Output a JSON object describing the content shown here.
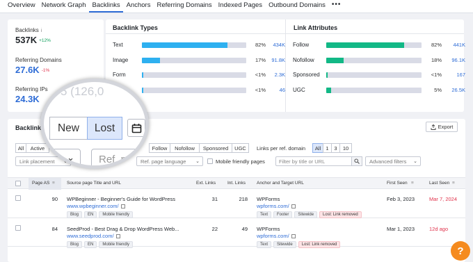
{
  "tabs": [
    "Overview",
    "Network Graph",
    "Backlinks",
    "Anchors",
    "Referring Domains",
    "Indexed Pages",
    "Outbound Domains"
  ],
  "tabs_more": "•••",
  "stats": {
    "backlinks": {
      "label": "Backlinks",
      "info": "i",
      "value": "537K",
      "delta": "+12%"
    },
    "referring_domains": {
      "label": "Referring Domains",
      "value": "27.6K",
      "delta": "-1%"
    },
    "referring_ips": {
      "label": "Referring IPs",
      "value": "24.3K"
    }
  },
  "backlink_types": {
    "title": "Backlink Types",
    "rows": [
      {
        "label": "Text",
        "pct": "82%",
        "count": "434K",
        "fill": 0.82
      },
      {
        "label": "Image",
        "pct": "17%",
        "count": "91.8K",
        "fill": 0.17
      },
      {
        "label": "Form",
        "pct": "<1%",
        "count": "2.3K",
        "fill": 0.005
      },
      {
        "label": "Frame",
        "pct": "<1%",
        "count": "46",
        "fill": 0.005
      }
    ]
  },
  "link_attributes": {
    "title": "Link Attributes",
    "rows": [
      {
        "label": "Follow",
        "pct": "82%",
        "count": "441K",
        "fill": 0.82
      },
      {
        "label": "Nofollow",
        "pct": "18%",
        "count": "96.1K",
        "fill": 0.18
      },
      {
        "label": "Sponsored",
        "pct": "<1%",
        "count": "167",
        "fill": 0.005
      },
      {
        "label": "UGC",
        "pct": "5%",
        "count": "26.5K",
        "fill": 0.05
      }
    ]
  },
  "colors": {
    "accent": "#2e6cd6",
    "types_bar": "#2eb0f0",
    "follow_bar": "#12b886",
    "negative": "#e0324b",
    "positive": "#0a9d58",
    "help": "#f58b1f"
  },
  "backlinks_section": {
    "title": "Backlinks",
    "export_label": "Export",
    "export_icon": "export-icon"
  },
  "filters": {
    "type_options": [
      "All",
      "Active"
    ],
    "attr_options": [
      "Follow",
      "Nofollow",
      "Sponsored",
      "UGC"
    ],
    "per_domain_label": "Links per ref. domain",
    "per_domain_options": [
      "All",
      "1",
      "3",
      "10"
    ],
    "link_placement": "Link placement",
    "ref_page_language": "Ref. page language",
    "mobile_friendly": "Mobile friendly pages",
    "search_placeholder": "Filter by title or URL",
    "advanced_filters": "Advanced filters"
  },
  "magnifier": {
    "ghost_text": "5 (126,0",
    "new_label": "New",
    "lost_label": "Lost",
    "input1_text": "nt",
    "input2_text": "Ref. page"
  },
  "table": {
    "headers": {
      "page_as": "Page AS",
      "source": "Source page Title and URL",
      "ext_links": "Ext. Links",
      "int_links": "Int. Links",
      "anchor": "Anchor and Target URL",
      "first_seen": "First Seen",
      "last_seen": "Last Seen"
    },
    "rows": [
      {
        "page_as": "90",
        "title": "WPBeginner - Beginner's Guide for WordPress",
        "url": "www.wpbeginner.com/",
        "tags": [
          "Blog",
          "EN",
          "Mobile friendly"
        ],
        "ext_links": "31",
        "int_links": "218",
        "anchor": "WPForms",
        "target": "wpforms.com/",
        "anchor_tags": [
          "Text",
          "Footer",
          "Sitewide"
        ],
        "status": "Lost: Link removed",
        "first_seen": "Feb 3, 2023",
        "last_seen": "Mar 7, 2024"
      },
      {
        "page_as": "84",
        "title": "SeedProd - Best Drag & Drop WordPress Web...",
        "url": "www.seedprod.com/",
        "tags": [
          "Blog",
          "EN",
          "Mobile friendly"
        ],
        "ext_links": "22",
        "int_links": "49",
        "anchor": "WPForms",
        "target": "wpforms.com/",
        "anchor_tags": [
          "Text",
          "Sitewide"
        ],
        "status": "Lost: Link removed",
        "first_seen": "Mar 1, 2023",
        "last_seen": "12d ago"
      }
    ]
  },
  "help_label": "?"
}
